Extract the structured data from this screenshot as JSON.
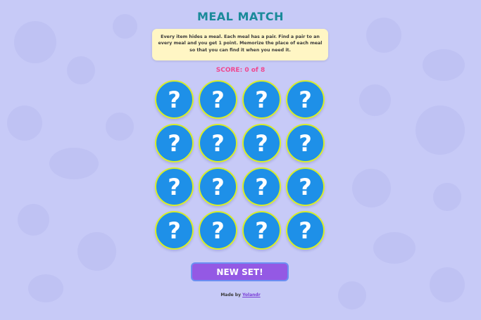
{
  "game": {
    "title": "MEAL MATCH",
    "instructions": "Every item hides a meal. Each meal has a pair. Find a pair to an every meal and you get 1 point. Memorize the place of each meal so that you can find it when you need it.",
    "score_label": "SCORE:",
    "score": "0",
    "score_sep": "of",
    "score_total": "8",
    "card_symbol": "?",
    "cards": [
      "?",
      "?",
      "?",
      "?",
      "?",
      "?",
      "?",
      "?",
      "?",
      "?",
      "?",
      "?",
      "?",
      "?",
      "?",
      "?"
    ],
    "new_set_label": "NEW SET!",
    "credit_prefix": "Made by",
    "credit_author": "Yolandr"
  },
  "colors": {
    "background": "#c7caf7",
    "title": "#1a8a9a",
    "score": "#f0478f",
    "card_fill": "#1e90e8",
    "card_ring": "#d9ee2a",
    "button": "#9459e4",
    "button_border": "#6b8ff2",
    "instructions_bg": "#fff6c4"
  }
}
